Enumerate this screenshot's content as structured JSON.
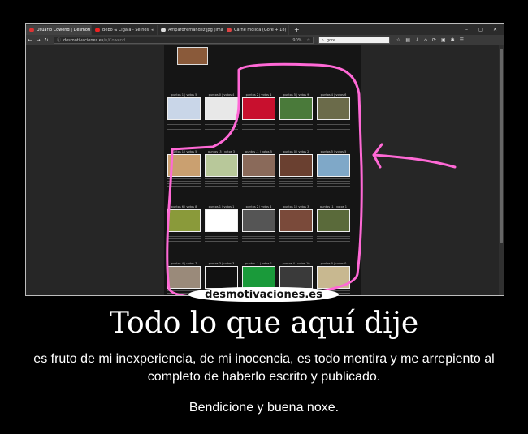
{
  "browser": {
    "tabs": [
      {
        "label": "Usuario Cowend | Desmoti",
        "favicon_color": "#d33"
      },
      {
        "label": "Bebo & Cigala - Se nos",
        "favicon_color": "#e22"
      },
      {
        "label": "AmparoFernandez.jpg (Ima",
        "favicon_color": "#ddd"
      },
      {
        "label": "Carne molida (Gore + 18) |",
        "favicon_color": "#d44"
      }
    ],
    "new_tab": "+",
    "window_controls": [
      "–",
      "◻",
      "✕"
    ],
    "url_domain": "desmotivaciones.es",
    "url_path": "/u/Cowend",
    "zoom": "90%",
    "search_value": "gore"
  },
  "grid": {
    "rows": [
      [
        {
          "meta": "puntos 1 | votos 5",
          "color": "#c9d6e8"
        },
        {
          "meta": "puntos 0 | votos 4",
          "color": "#e8e8e8"
        },
        {
          "meta": "puntos 2 | votos 4",
          "color": "#c8102e"
        },
        {
          "meta": "puntos 5 | votos 9",
          "color": "#4a7a3a"
        },
        {
          "meta": "puntos 4 | votos 6",
          "color": "#6b6b4a"
        }
      ],
      [
        {
          "meta": "puntos 1 | votos 5",
          "color": "#caa070"
        },
        {
          "meta": "puntos -3 | votos 3",
          "color": "#b8c89a"
        },
        {
          "meta": "puntos -1 | votos 5",
          "color": "#8a6a5a"
        },
        {
          "meta": "puntos 0 | votos 2",
          "color": "#6a4030"
        },
        {
          "meta": "puntos 5 | votos 5",
          "color": "#7fa8c8"
        }
      ],
      [
        {
          "meta": "puntos 6 | votos 8",
          "color": "#8a9a3a"
        },
        {
          "meta": "puntos 1 | votos 1",
          "color": "#ffffff"
        },
        {
          "meta": "puntos 2 | votos 4",
          "color": "#555555"
        },
        {
          "meta": "puntos 1 | votos 3",
          "color": "#7a4a3a"
        },
        {
          "meta": "puntos -1 | votos 1",
          "color": "#5a6a3a"
        }
      ],
      [
        {
          "meta": "puntos 4 | votos 7",
          "color": "#9a8a7a"
        },
        {
          "meta": "puntos 3 | votos 3",
          "color": "#111111"
        },
        {
          "meta": "puntos -1 | votos 1",
          "color": "#1a9a3a"
        },
        {
          "meta": "puntos 4 | votos 10",
          "color": "#3a3a3a"
        },
        {
          "meta": "puntos 0 | votos 0",
          "color": "#c8b890"
        }
      ]
    ]
  },
  "annotation": {
    "stroke_color": "#ff69d6"
  },
  "logo": "desmotivaciones.es",
  "poster": {
    "title": "Todo lo que aquí dije",
    "subtitle": "es fruto de mi inexperiencia, de mi inocencia, es todo mentira y me arrepiento al completo de haberlo escrito y publicado.",
    "closing": "Bendicione y buena noxe."
  }
}
